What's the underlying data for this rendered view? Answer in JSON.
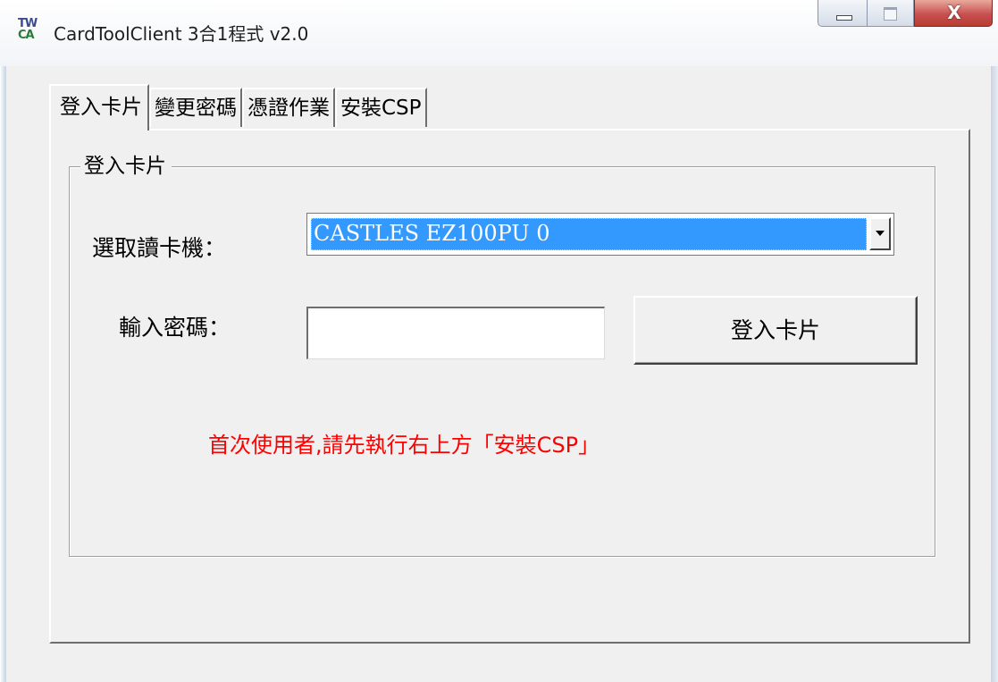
{
  "window": {
    "logo_top": "TW",
    "logo_bottom": "CA",
    "title": "CardToolClient 3合1程式 v2.0",
    "controls": {
      "close_glyph": "X"
    }
  },
  "tabs": [
    {
      "label": "登入卡片",
      "active": true
    },
    {
      "label": "變更密碼",
      "active": false
    },
    {
      "label": "憑證作業",
      "active": false
    },
    {
      "label": "安裝CSP",
      "active": false
    }
  ],
  "login_panel": {
    "group_title": "登入卡片",
    "reader_label": "選取讀卡機：",
    "reader_selected": "CASTLES EZ100PU 0",
    "password_label": "輸入密碼：",
    "password_value": "",
    "login_button": "登入卡片",
    "hint": "首次使用者,請先執行右上方「安裝CSP」",
    "hint_color": "#ff0000",
    "selection_color": "#3399ff"
  }
}
